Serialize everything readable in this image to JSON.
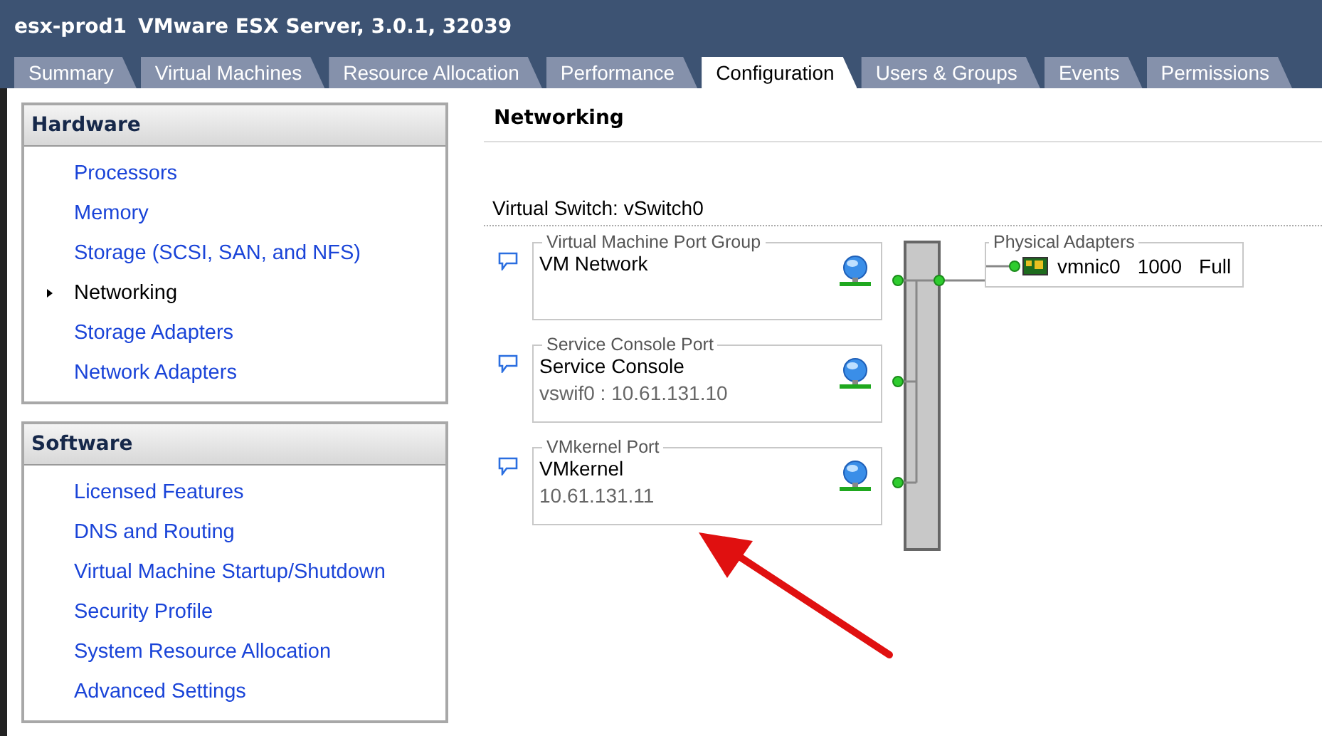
{
  "window": {
    "host": "esx-prod1",
    "title": "VMware ESX Server, 3.0.1, 32039"
  },
  "tabs": [
    {
      "label": "Summary",
      "selected": false
    },
    {
      "label": "Virtual Machines",
      "selected": false
    },
    {
      "label": "Resource Allocation",
      "selected": false
    },
    {
      "label": "Performance",
      "selected": false
    },
    {
      "label": "Configuration",
      "selected": true
    },
    {
      "label": "Users & Groups",
      "selected": false
    },
    {
      "label": "Events",
      "selected": false
    },
    {
      "label": "Permissions",
      "selected": false
    }
  ],
  "sidebar": [
    {
      "title": "Hardware",
      "items": [
        {
          "label": "Processors",
          "selected": false
        },
        {
          "label": "Memory",
          "selected": false
        },
        {
          "label": "Storage (SCSI, SAN, and NFS)",
          "selected": false
        },
        {
          "label": "Networking",
          "selected": true
        },
        {
          "label": "Storage Adapters",
          "selected": false
        },
        {
          "label": "Network Adapters",
          "selected": false
        }
      ]
    },
    {
      "title": "Software",
      "items": [
        {
          "label": "Licensed Features",
          "selected": false
        },
        {
          "label": "DNS and Routing",
          "selected": false
        },
        {
          "label": "Virtual Machine Startup/Shutdown",
          "selected": false
        },
        {
          "label": "Security Profile",
          "selected": false
        },
        {
          "label": "System Resource Allocation",
          "selected": false
        },
        {
          "label": "Advanced Settings",
          "selected": false
        }
      ]
    }
  ],
  "content": {
    "heading": "Networking",
    "switch_label": "Virtual Switch: vSwitch0",
    "port_groups": [
      {
        "group": "Virtual Machine Port Group",
        "name": "VM Network"
      },
      {
        "group": "Service Console Port",
        "name": "Service Console",
        "detail": "vswif0 : 10.61.131.10"
      },
      {
        "group": "VMkernel Port",
        "name": "VMkernel",
        "detail": "10.61.131.11"
      }
    ],
    "physical_adapters": {
      "label": "Physical Adapters",
      "adapters": [
        {
          "name": "vmnic0",
          "speed": "1000",
          "duplex": "Full"
        }
      ]
    }
  }
}
